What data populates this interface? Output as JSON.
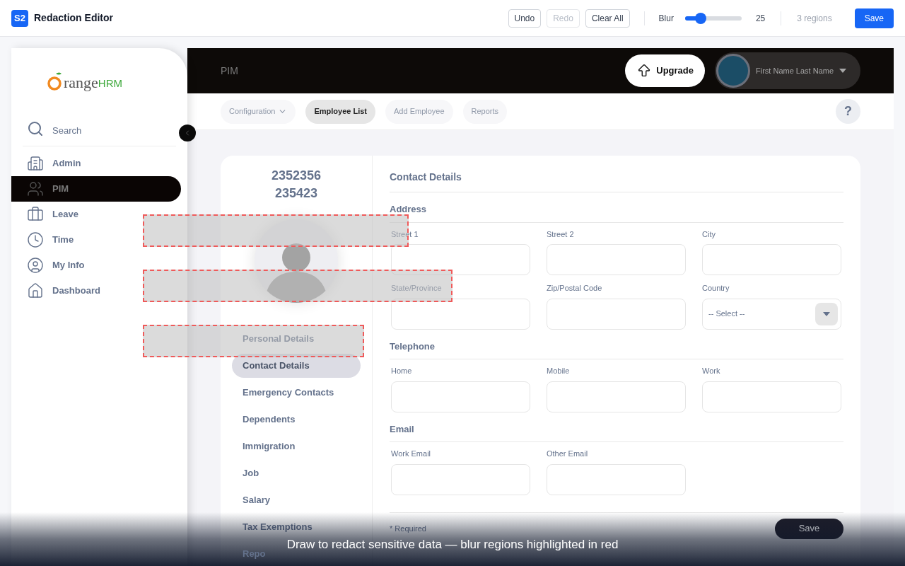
{
  "toolbar": {
    "badge": "S2",
    "title": "Redaction Editor",
    "buttons": [
      {
        "label": "Undo",
        "disabled": false
      },
      {
        "label": "Redo",
        "disabled": true
      },
      {
        "label": "Clear All",
        "disabled": false
      }
    ],
    "blur": {
      "label": "Blur",
      "level": 0.25,
      "reading": "25"
    },
    "region_count": "3 regions",
    "save": "Save"
  },
  "sidebar": {
    "logo": {
      "text": "range",
      "suffix": "HRM"
    },
    "search": "Search",
    "items": [
      {
        "label": "Admin",
        "selected": false,
        "kind": "admin"
      },
      {
        "label": "PIM",
        "selected": true,
        "kind": "pim"
      },
      {
        "label": "Leave",
        "selected": false,
        "kind": "leave"
      },
      {
        "label": "Time",
        "selected": false,
        "kind": "time"
      },
      {
        "label": "My Info",
        "selected": false,
        "kind": "info"
      },
      {
        "label": "Dashboard",
        "selected": false,
        "kind": "dashboard"
      }
    ]
  },
  "header": {
    "title": "PIM",
    "upgrade": "Upgrade",
    "user": "First Name Last Name"
  },
  "nav": {
    "tabs": [
      {
        "label": "Configuration",
        "selected": false,
        "dropdown": true
      },
      {
        "label": "Employee List",
        "selected": true,
        "dropdown": false
      },
      {
        "label": "Add Employee",
        "selected": false,
        "dropdown": false
      },
      {
        "label": "Reports",
        "selected": false,
        "dropdown": false
      }
    ],
    "help": "?"
  },
  "employee": {
    "name_lines": [
      "2352356",
      "235423"
    ],
    "tabs": [
      {
        "label": "Personal Details",
        "selected": false
      },
      {
        "label": "Contact Details",
        "selected": true
      },
      {
        "label": "Emergency Contacts",
        "selected": false
      },
      {
        "label": "Dependents",
        "selected": false
      },
      {
        "label": "Immigration",
        "selected": false
      },
      {
        "label": "Job",
        "selected": false
      },
      {
        "label": "Salary",
        "selected": false
      },
      {
        "label": "Tax Exemptions",
        "selected": false
      },
      {
        "label": "Repo",
        "selected": false
      }
    ]
  },
  "form": {
    "title": "Contact Details",
    "sections": [
      {
        "title": "Address",
        "fields": [
          {
            "label": "Street 1",
            "kind": "text"
          },
          {
            "label": "Street 2",
            "kind": "text"
          },
          {
            "label": "City",
            "kind": "text"
          },
          {
            "label": "State/Province",
            "kind": "text"
          },
          {
            "label": "Zip/Postal Code",
            "kind": "text"
          },
          {
            "label": "Country",
            "kind": "select",
            "value": "-- Select --"
          }
        ]
      },
      {
        "title": "Telephone",
        "fields": [
          {
            "label": "Home",
            "kind": "text"
          },
          {
            "label": "Mobile",
            "kind": "text"
          },
          {
            "label": "Work",
            "kind": "text"
          }
        ]
      },
      {
        "title": "Email",
        "fields": [
          {
            "label": "Work Email",
            "kind": "text"
          },
          {
            "label": "Other Email",
            "kind": "text"
          }
        ]
      }
    ],
    "required": "* Required",
    "save": "Save"
  },
  "hint": "Draw to redact sensitive data — blur regions highlighted in red"
}
